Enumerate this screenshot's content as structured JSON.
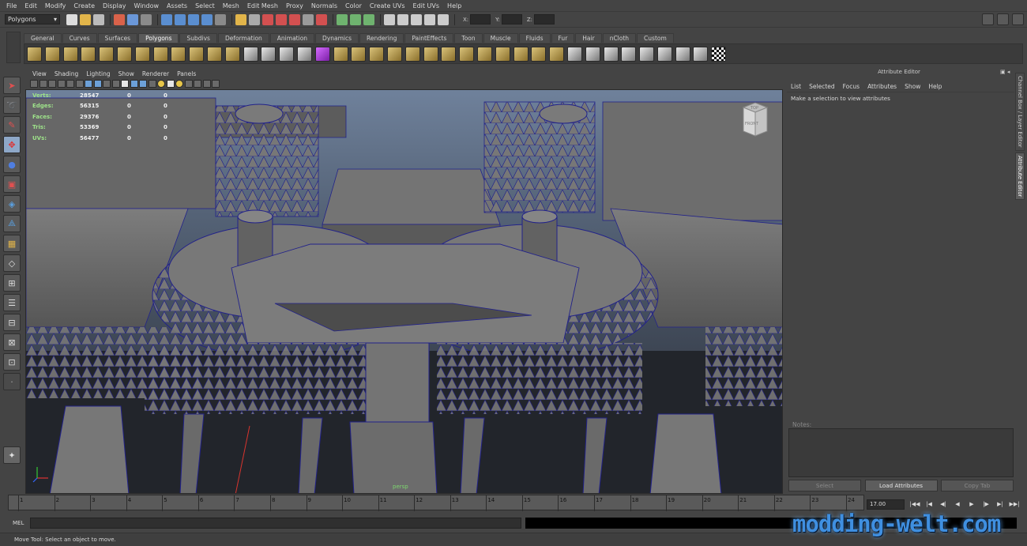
{
  "menubar": [
    "File",
    "Edit",
    "Modify",
    "Create",
    "Display",
    "Window",
    "Assets",
    "Select",
    "Mesh",
    "Edit Mesh",
    "Proxy",
    "Normals",
    "Color",
    "Create UVs",
    "Edit UVs",
    "Help"
  ],
  "statusline": {
    "mode": "Polygons",
    "x_label": "X:",
    "y_label": "Y:",
    "z_label": "Z:"
  },
  "shelf_tabs": [
    "General",
    "Curves",
    "Surfaces",
    "Polygons",
    "Subdivs",
    "Deformation",
    "Animation",
    "Dynamics",
    "Rendering",
    "PaintEffects",
    "Toon",
    "Muscle",
    "Fluids",
    "Fur",
    "Hair",
    "nCloth",
    "Custom"
  ],
  "shelf_active": "Polygons",
  "viewport": {
    "menus": [
      "View",
      "Shading",
      "Lighting",
      "Show",
      "Renderer",
      "Panels"
    ],
    "camera": "persp",
    "viewcube": {
      "top": "TOP",
      "front": "FRONT"
    },
    "hud": [
      {
        "label": "Verts:",
        "total": "28547",
        "selected": "0",
        "uv": "0"
      },
      {
        "label": "Edges:",
        "total": "56315",
        "selected": "0",
        "uv": "0"
      },
      {
        "label": "Faces:",
        "total": "29376",
        "selected": "0",
        "uv": "0"
      },
      {
        "label": "Tris:",
        "total": "53369",
        "selected": "0",
        "uv": "0"
      },
      {
        "label": "UVs:",
        "total": "56477",
        "selected": "0",
        "uv": "0"
      }
    ]
  },
  "attribute_editor": {
    "title": "Attribute Editor",
    "menus": [
      "List",
      "Selected",
      "Focus",
      "Attributes",
      "Show",
      "Help"
    ],
    "hint": "Make a selection to view attributes",
    "notes_label": "Notes:",
    "buttons": {
      "select": "Select",
      "load": "Load Attributes",
      "copy": "Copy Tab"
    }
  },
  "side_tabs": [
    "Channel Box / Layer Editor",
    "Attribute Editor"
  ],
  "timeline": {
    "ticks": [
      "1",
      "2",
      "3",
      "4",
      "5",
      "6",
      "7",
      "8",
      "9",
      "10",
      "11",
      "12",
      "13",
      "14",
      "15",
      "16",
      "17",
      "18",
      "19",
      "20",
      "21",
      "22",
      "23",
      "24"
    ],
    "current_frame": "17.00",
    "playback": [
      "|◀◀",
      "|◀",
      "◀|",
      "◀",
      "▶",
      "|▶",
      "▶|",
      "▶▶|"
    ]
  },
  "command_line": {
    "label": "MEL"
  },
  "help_line": "Move Tool: Select an object to move.",
  "watermark": "modding-welt.com",
  "colors": {
    "ui_bg": "#444444",
    "viewport_sky": "#6c7d96",
    "wireframe": "#22228a",
    "hud_label": "#9ee38a"
  }
}
